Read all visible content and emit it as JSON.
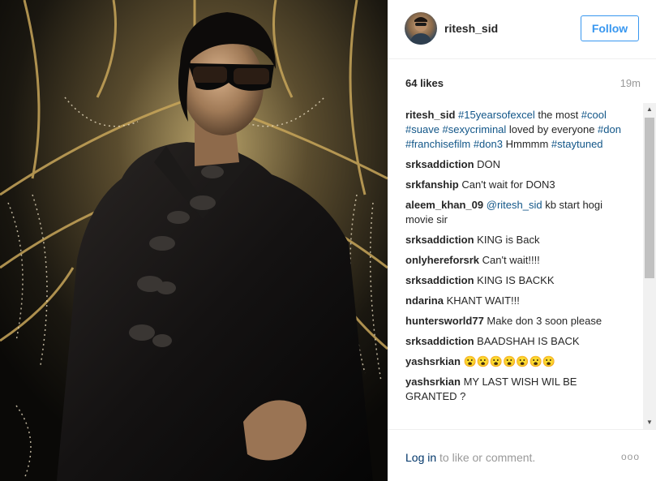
{
  "post": {
    "image_alt": "Man in black velvet jacket and dark sunglasses under a chandelier"
  },
  "header": {
    "username": "ritesh_sid",
    "follow_label": "Follow"
  },
  "stats": {
    "likes": "64 likes",
    "time": "19m"
  },
  "caption": {
    "username": "ritesh_sid",
    "parts": [
      {
        "type": "tag",
        "text": "#15yearsofexcel"
      },
      {
        "type": "text",
        "text": " the most "
      },
      {
        "type": "tag",
        "text": "#cool"
      },
      {
        "type": "text",
        "text": " "
      },
      {
        "type": "tag",
        "text": "#suave"
      },
      {
        "type": "text",
        "text": " "
      },
      {
        "type": "tag",
        "text": "#sexycriminal"
      },
      {
        "type": "text",
        "text": " loved by everyone "
      },
      {
        "type": "tag",
        "text": "#don"
      },
      {
        "type": "text",
        "text": " "
      },
      {
        "type": "tag",
        "text": "#franchisefilm"
      },
      {
        "type": "text",
        "text": " "
      },
      {
        "type": "tag",
        "text": "#don3"
      },
      {
        "type": "text",
        "text": " Hmmmm "
      },
      {
        "type": "tag",
        "text": "#staytuned"
      }
    ]
  },
  "comments": [
    {
      "user": "srksaddiction",
      "parts": [
        {
          "type": "text",
          "text": "DON"
        }
      ]
    },
    {
      "user": "srkfanship",
      "parts": [
        {
          "type": "text",
          "text": "Can't wait for DON3"
        }
      ]
    },
    {
      "user": "aleem_khan_09",
      "parts": [
        {
          "type": "tag",
          "text": "@ritesh_sid"
        },
        {
          "type": "text",
          "text": " kb start hogi movie sir"
        }
      ]
    },
    {
      "user": "srksaddiction",
      "parts": [
        {
          "type": "text",
          "text": "KING is Back"
        }
      ]
    },
    {
      "user": "onlyhereforsrk",
      "parts": [
        {
          "type": "text",
          "text": "Can't wait!!!!"
        }
      ]
    },
    {
      "user": "srksaddiction",
      "parts": [
        {
          "type": "text",
          "text": "KING IS BACKK"
        }
      ]
    },
    {
      "user": "ndarina",
      "parts": [
        {
          "type": "text",
          "text": "KHANT WAIT!!!"
        }
      ]
    },
    {
      "user": "huntersworld77",
      "parts": [
        {
          "type": "text",
          "text": "Make don 3 soon please"
        }
      ]
    },
    {
      "user": "srksaddiction",
      "parts": [
        {
          "type": "text",
          "text": "BAADSHAH IS BACK"
        }
      ]
    },
    {
      "user": "yashsrkian",
      "parts": [
        {
          "type": "text",
          "text": "😮😮😮😮😮😮😮"
        }
      ]
    },
    {
      "user": "yashsrkian",
      "parts": [
        {
          "type": "text",
          "text": "MY LAST WISH WIL BE GRANTED ?"
        }
      ]
    }
  ],
  "footer": {
    "login_link": "Log in",
    "login_rest": " to like or comment.",
    "more": "ooo"
  },
  "colors": {
    "accent": "#3897f0",
    "hashtag": "#125688",
    "muted": "#999999"
  },
  "icons": {
    "more": "ellipsis-icon",
    "scroll_up": "scroll-up-arrow-icon",
    "scroll_down": "scroll-down-arrow-icon"
  }
}
